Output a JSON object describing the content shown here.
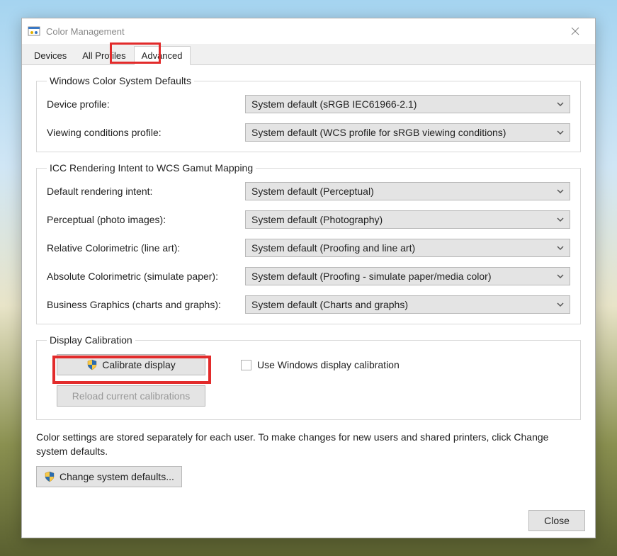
{
  "window": {
    "title": "Color Management"
  },
  "tabs": {
    "devices": "Devices",
    "allProfiles": "All Profiles",
    "advanced": "Advanced"
  },
  "group1": {
    "legend": "Windows Color System Defaults",
    "deviceProfile": {
      "label": "Device profile:",
      "value": "System default (sRGB IEC61966-2.1)"
    },
    "viewingConditions": {
      "label": "Viewing conditions profile:",
      "value": "System default (WCS profile for sRGB viewing conditions)"
    }
  },
  "group2": {
    "legend": "ICC Rendering Intent to WCS Gamut Mapping",
    "defaultIntent": {
      "label": "Default rendering intent:",
      "value": "System default (Perceptual)"
    },
    "perceptual": {
      "label": "Perceptual (photo images):",
      "value": "System default (Photography)"
    },
    "relative": {
      "label": "Relative Colorimetric (line art):",
      "value": "System default (Proofing and line art)"
    },
    "absolute": {
      "label": "Absolute Colorimetric (simulate paper):",
      "value": "System default (Proofing - simulate paper/media color)"
    },
    "business": {
      "label": "Business Graphics (charts and graphs):",
      "value": "System default (Charts and graphs)"
    }
  },
  "group3": {
    "legend": "Display Calibration",
    "calibrate": "Calibrate display",
    "useWindows": "Use Windows display calibration",
    "reload": "Reload current calibrations"
  },
  "info": "Color settings are stored separately for each user. To make changes for new users and shared printers, click Change system defaults.",
  "changeDefaults": "Change system defaults...",
  "close": "Close"
}
